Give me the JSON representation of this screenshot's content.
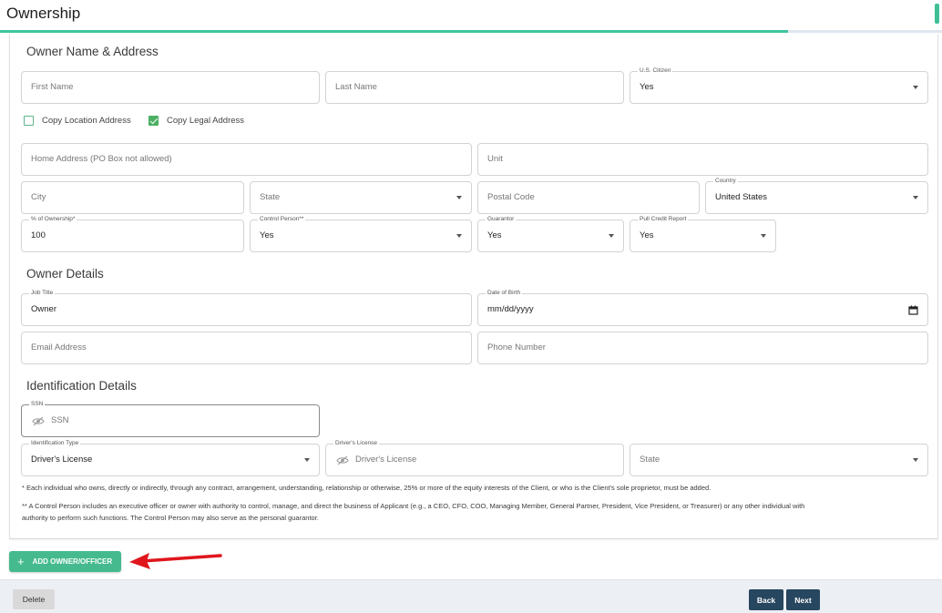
{
  "header": {
    "title": "Ownership",
    "progress": 0.837,
    "progress_color": "#3fc59d"
  },
  "sections": {
    "owner_name_address": "Owner Name & Address",
    "owner_details": "Owner Details",
    "identification_details": "Identification Details"
  },
  "fields": {
    "first_name": {
      "placeholder": "First Name"
    },
    "last_name": {
      "placeholder": "Last Name"
    },
    "us_citizen": {
      "label": "U.S. Citizen",
      "value": "Yes"
    },
    "copy_location": {
      "label": "Copy Location Address",
      "checked": false
    },
    "copy_legal": {
      "label": "Copy Legal Address",
      "checked": true
    },
    "home_address": {
      "placeholder": "Home Address (PO Box not allowed)"
    },
    "unit": {
      "placeholder": "Unit"
    },
    "city": {
      "placeholder": "City"
    },
    "state": {
      "placeholder": "State"
    },
    "postal_code": {
      "placeholder": "Postal Code"
    },
    "country": {
      "label": "Country",
      "value": "United States"
    },
    "ownership_pct": {
      "label": "% of Ownership*",
      "value": "100"
    },
    "control_person": {
      "label": "Control Person**",
      "value": "Yes"
    },
    "guarantor": {
      "label": "Guarantor",
      "value": "Yes"
    },
    "pull_credit": {
      "label": "Pull Credit Report",
      "value": "Yes"
    },
    "job_title": {
      "label": "Job Title",
      "value": "Owner"
    },
    "dob": {
      "label": "Date of Birth",
      "value": "mm/dd/yyyy"
    },
    "email": {
      "placeholder": "Email Address"
    },
    "phone": {
      "placeholder": "Phone Number"
    },
    "ssn": {
      "label": "SSN",
      "placeholder": "SSN"
    },
    "id_type": {
      "label": "Identification Type",
      "value": "Driver's License"
    },
    "drivers_license": {
      "label": "Driver's License",
      "placeholder": "Driver's License"
    },
    "id_state": {
      "placeholder": "State"
    }
  },
  "notes": {
    "note1": "* Each individual who owns, directly or indirectly, through any contract, arrangement, understanding, relationship or otherwise, 25% or more of the equity interests of the Client, or who is the Client's sole proprietor, must be added.",
    "note2a": "** A Control Person includes an executive officer or owner with authority to control, manage, and direct the business of Applicant (e.g., a CEO, CFO, COO, Managing Member, General Partner, President, Vice President, or Treasurer) or any other individual with",
    "note2b": "authority to perform such functions. The Control Person may also serve as the personal guarantor."
  },
  "buttons": {
    "add_owner": "ADD OWNER/OFFICER",
    "delete": "Delete",
    "back": "Back",
    "next": "Next"
  },
  "colors": {
    "accent": "#45ba8f",
    "nav_button": "#27465f",
    "annotation_arrow": "#e0161d"
  },
  "icons": {
    "visibility_off": "eye-off-icon",
    "calendar": "calendar-icon",
    "plus": "plus-icon",
    "checkmark": "check-icon"
  }
}
